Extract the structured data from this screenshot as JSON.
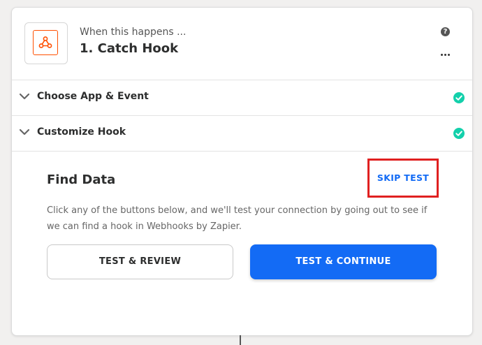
{
  "header": {
    "subtitle": "When this happens ...",
    "title": "1. Catch Hook",
    "app_icon": "webhook-icon",
    "help_icon_glyph": "?"
  },
  "sections": [
    {
      "label": "Choose App & Event",
      "status": "complete"
    },
    {
      "label": "Customize Hook",
      "status": "complete"
    }
  ],
  "find_data": {
    "title": "Find Data",
    "skip_label": "SKIP TEST",
    "description": "Click any of the buttons below, and we'll test your connection by going out to see if we can find a hook in Webhooks by Zapier.",
    "review_label": "TEST & REVIEW",
    "continue_label": "TEST & CONTINUE"
  },
  "colors": {
    "accent_blue": "#136bf5",
    "check_green": "#13d0ab",
    "brand_orange": "#ff4f00",
    "highlight_red": "#e02020"
  }
}
